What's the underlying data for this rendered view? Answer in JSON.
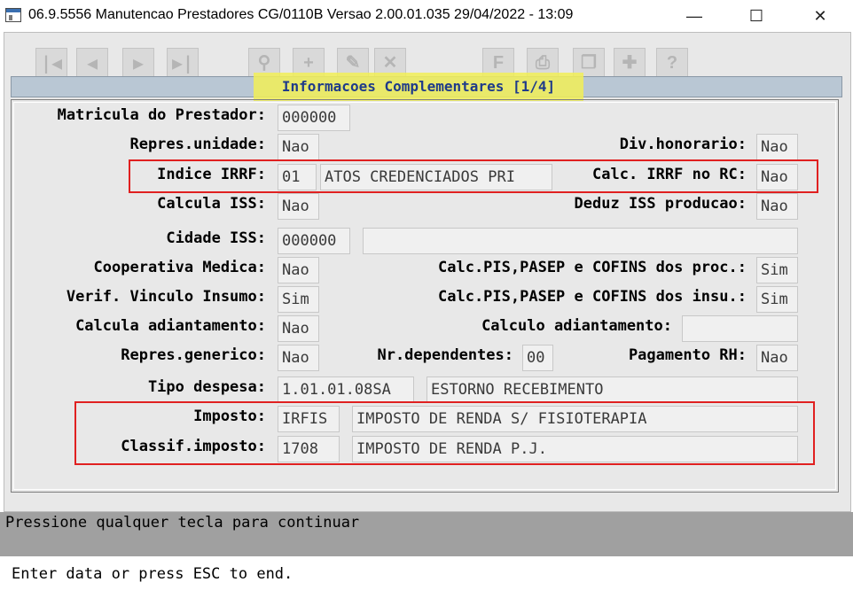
{
  "window": {
    "title": "06.9.5556 Manutencao  Prestadores CG/0110B Versao 2.00.01.035 29/04/2022 - 13:09",
    "minimize": "—",
    "maximize": "☐",
    "close": "✕"
  },
  "toolbar": {
    "first": "|◀",
    "prev": "◀",
    "next": "▶",
    "last": "▶|",
    "search": "⚲",
    "add": "+",
    "edit": "✎",
    "delete": "✕",
    "report": "F",
    "print": "⎙",
    "copy": "❐",
    "tools": "✚",
    "help": "?"
  },
  "frame": {
    "title": "Informacoes Complementares [1/4]"
  },
  "fields": {
    "matricula": {
      "label": "Matricula do Prestador:",
      "value": "000000"
    },
    "repres_unidade": {
      "label": "Repres.unidade:",
      "value": "Nao"
    },
    "div_honorario": {
      "label": "Div.honorario:",
      "value": "Nao"
    },
    "indice_irrf": {
      "label": "Indice IRRF:",
      "value": "01",
      "desc": "ATOS CREDENCIADOS PRI"
    },
    "calc_irrf_rc": {
      "label": "Calc. IRRF no RC:",
      "value": "Nao"
    },
    "calcula_iss": {
      "label": "Calcula ISS:",
      "value": "Nao"
    },
    "deduz_iss": {
      "label": "Deduz ISS producao:",
      "value": "Nao"
    },
    "cidade_iss": {
      "label": "Cidade ISS:",
      "value": "000000",
      "desc": ""
    },
    "coop_medica": {
      "label": "Cooperativa Medica:",
      "value": "Nao"
    },
    "calc_pis_proc": {
      "label": "Calc.PIS,PASEP e COFINS dos proc.:",
      "value": "Sim"
    },
    "verif_vinculo": {
      "label": "Verif. Vinculo Insumo:",
      "value": "Sim"
    },
    "calc_pis_insu": {
      "label": "Calc.PIS,PASEP e COFINS dos insu.:",
      "value": "Sim"
    },
    "calcula_adiant": {
      "label": "Calcula adiantamento:",
      "value": "Nao"
    },
    "calculo_adiant": {
      "label": "Calculo adiantamento:",
      "value": ""
    },
    "repres_generico": {
      "label": "Repres.generico:",
      "value": "Nao"
    },
    "nr_dependentes": {
      "label": "Nr.dependentes:",
      "value": "00"
    },
    "pagamento_rh": {
      "label": "Pagamento RH:",
      "value": "Nao"
    },
    "tipo_despesa": {
      "label": "Tipo despesa:",
      "value": "1.01.01.08SA",
      "desc": "ESTORNO RECEBIMENTO"
    },
    "imposto": {
      "label": "Imposto:",
      "value": "IRFIS",
      "desc": "IMPOSTO DE RENDA S/ FISIOTERAPIA"
    },
    "classif_imposto": {
      "label": "Classif.imposto:",
      "value": "1708",
      "desc": "IMPOSTO DE RENDA P.J."
    }
  },
  "status": {
    "message": "Pressione qualquer tecla para continuar",
    "hint": "Enter data or press ESC to end."
  },
  "colors": {
    "highlight": "#f1ee57",
    "annotation_box": "#e02020",
    "frame_header": "#b9c7d4",
    "message_bar": "#a0a0a0"
  }
}
